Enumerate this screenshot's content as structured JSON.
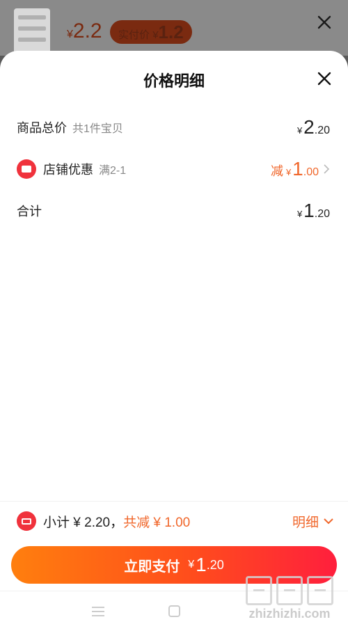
{
  "background": {
    "price_yen": "¥",
    "price": "2.2",
    "actual_label": "实付价",
    "actual_yen": "¥",
    "actual_price": "1.2"
  },
  "sheet": {
    "title": "价格明细",
    "rows": {
      "total": {
        "label": "商品总价",
        "sub": "共1件宝贝",
        "yen": "¥",
        "amount_int": "2",
        "amount_dec": ".20"
      },
      "shop_discount": {
        "label": "店铺优惠",
        "sub": "满2-1",
        "prefix": "减",
        "yen": "¥",
        "amount_int": "1",
        "amount_dec": ".00"
      },
      "sum": {
        "label": "合计",
        "yen": "¥",
        "amount_int": "1",
        "amount_dec": ".20"
      }
    }
  },
  "footer": {
    "subtotal_text": "小计 ¥ 2.20，",
    "discount_text": "共减 ¥ 1.00",
    "detail_label": "明细",
    "pay": {
      "label": "立即支付",
      "yen": "¥",
      "amount_int": "1",
      "amount_dec": ".20"
    }
  },
  "watermark": {
    "text": "zhizhizhi.com"
  },
  "colors": {
    "accent": "#f0662a",
    "badge_red": "#f0323c",
    "pay_gradient_start": "#ff7f0e",
    "pay_gradient_end": "#ff1f3d"
  }
}
